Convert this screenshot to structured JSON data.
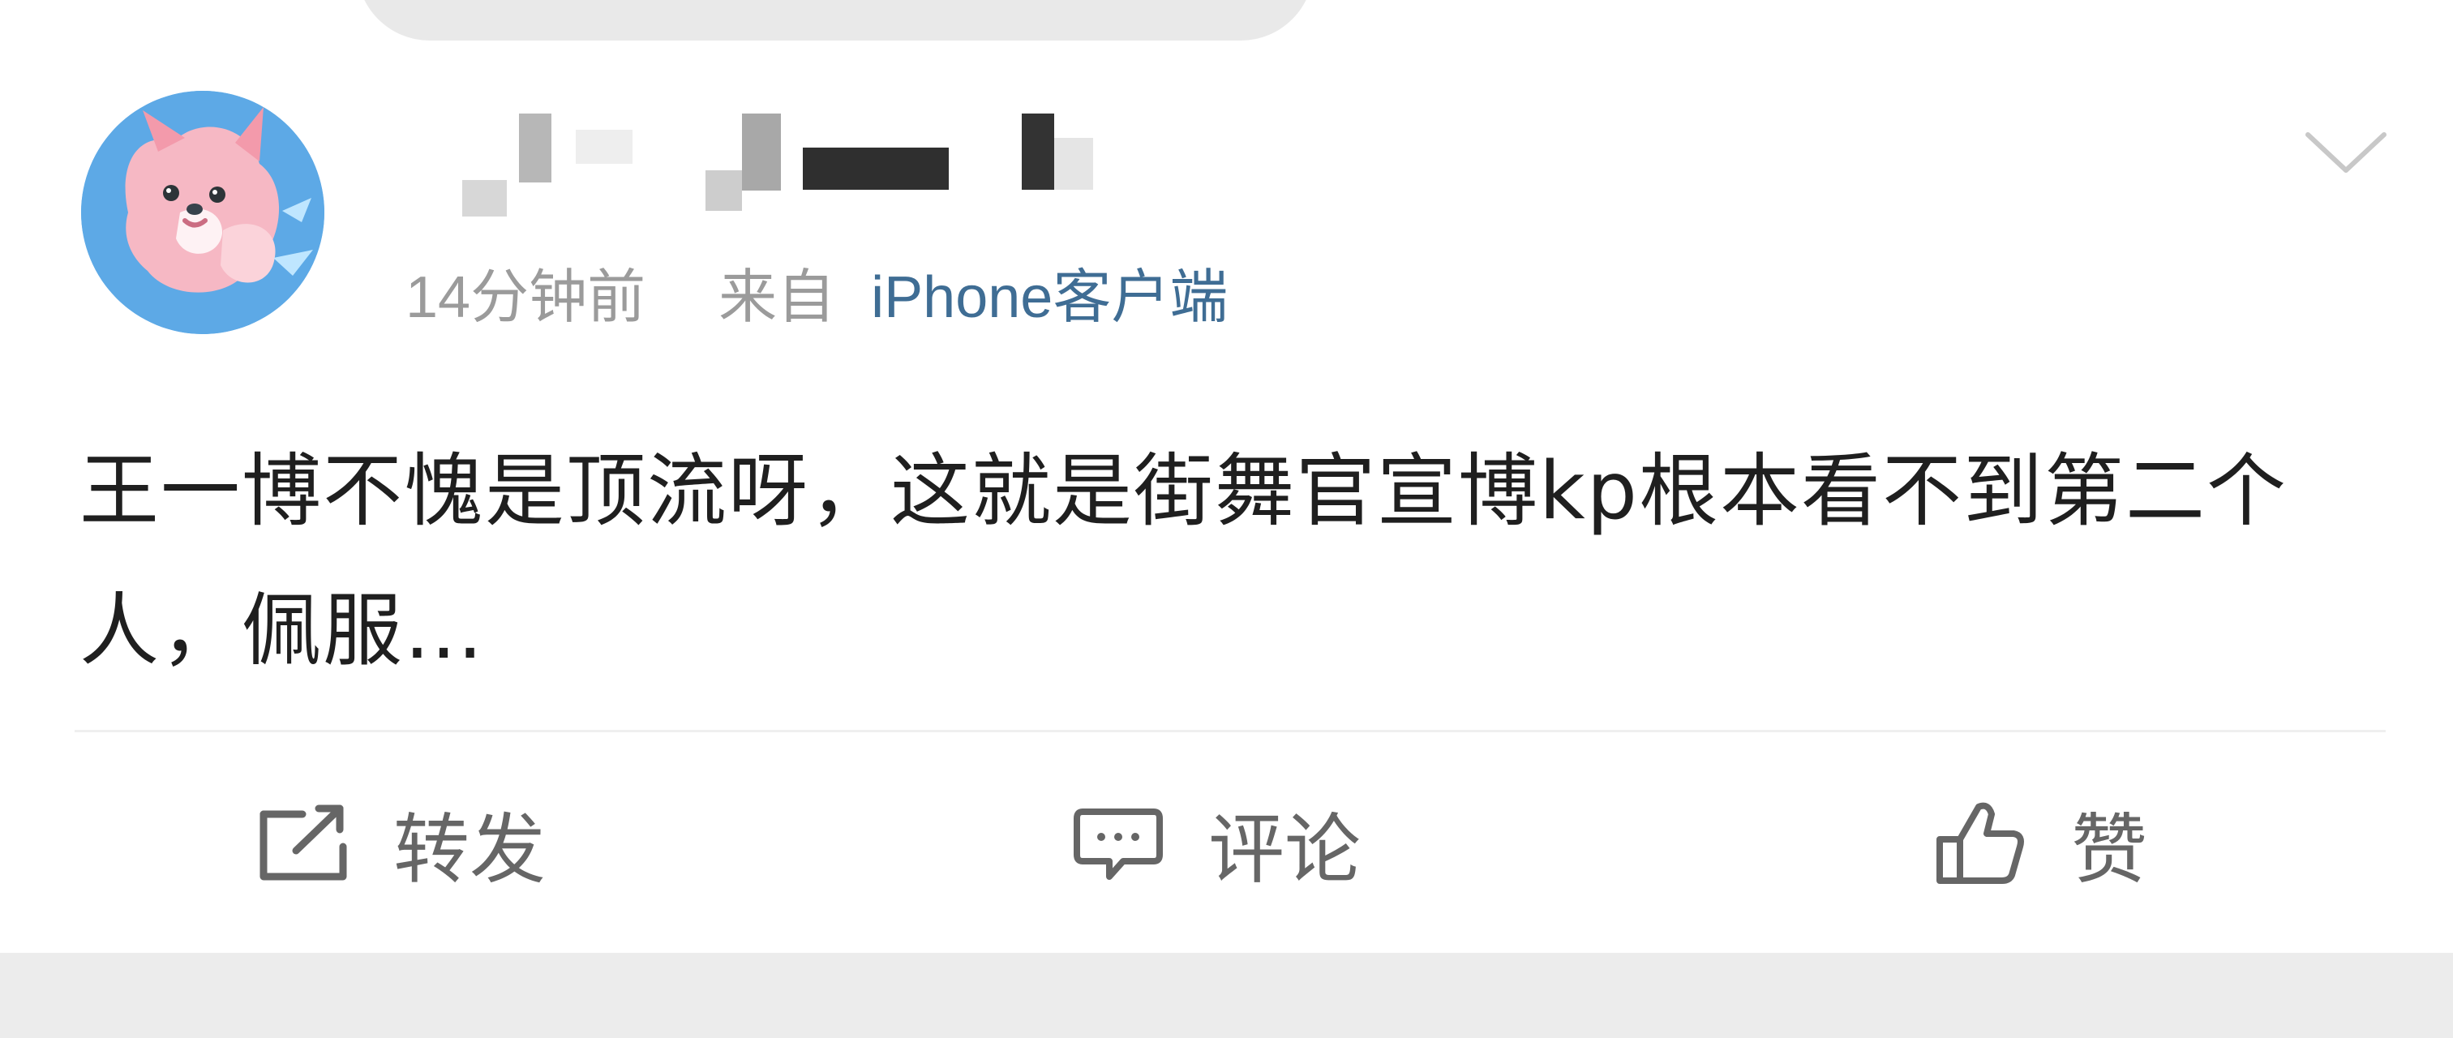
{
  "post": {
    "avatar_icon": "pink-fox-avatar-icon",
    "username_hidden": true,
    "time": "14分钟前",
    "from_label": "来自",
    "source": "iPhone客户端",
    "menu_icon": "chevron-down-icon",
    "content": "王一博不愧是顶流呀，这就是街舞官宣博kp根本看不到第二个人，佩服…"
  },
  "actions": {
    "repost": {
      "label": "转发",
      "icon": "share-icon"
    },
    "comment": {
      "label": "评论",
      "icon": "comment-icon"
    },
    "like": {
      "label": "赞",
      "icon": "thumbs-up-icon"
    }
  },
  "colors": {
    "avatar_bg": "#5da9e6",
    "source_link": "#3f6d94",
    "meta": "#9b9b9b",
    "content": "#1f1f1f",
    "action": "#666666"
  }
}
